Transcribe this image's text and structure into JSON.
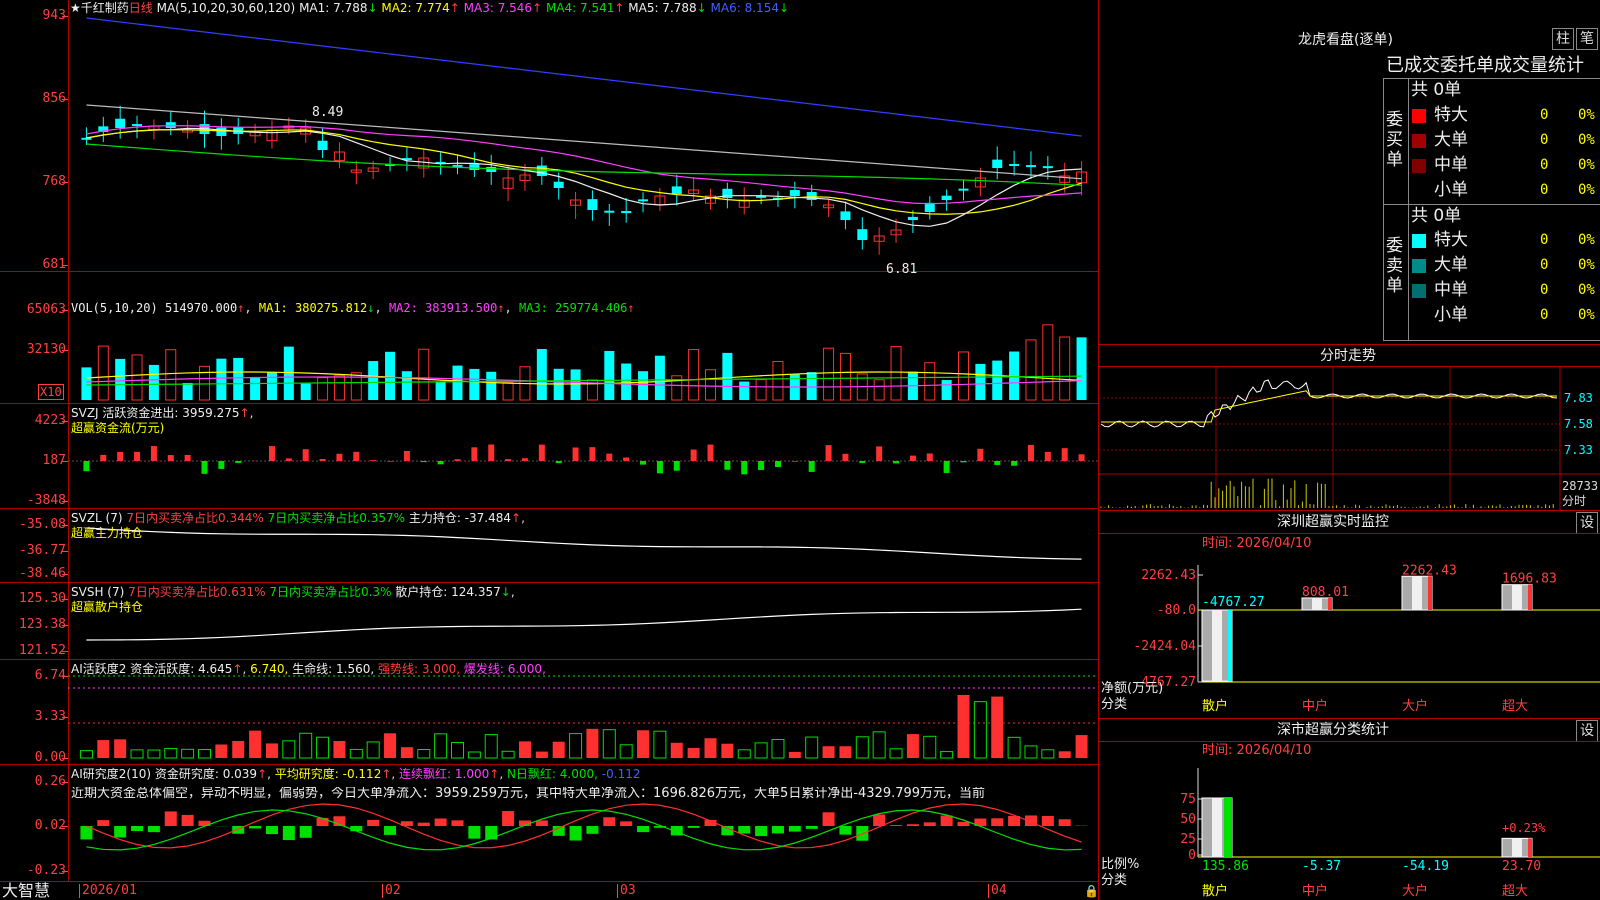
{
  "main_chart": {
    "stock_name": "★千红制药",
    "period": "日线",
    "ma_def": "MA(5,10,20,30,60,120)",
    "ma_values": [
      {
        "label": "MA1:",
        "value": "7.788",
        "arrow": "↓",
        "color": "#eeeeee"
      },
      {
        "label": "MA2:",
        "value": "7.774",
        "arrow": "↑",
        "color": "#ffff00"
      },
      {
        "label": "MA3:",
        "value": "7.546",
        "arrow": "↑",
        "color": "#ff40ff"
      },
      {
        "label": "MA4:",
        "value": "7.541",
        "arrow": "↑",
        "color": "#00e000"
      },
      {
        "label": "MA5:",
        "value": "7.788",
        "arrow": "↓",
        "color": "#eeeeee"
      },
      {
        "label": "MA6:",
        "value": "8.154",
        "arrow": "↓",
        "color": "#4060ff"
      }
    ],
    "y_ticks": [
      "943",
      "856",
      "768",
      "681"
    ],
    "high_marker": "8.49",
    "low_marker": "6.81"
  },
  "vol_panel": {
    "title": "VOL(5,10,20)",
    "value": "514970.000",
    "ma1": "MA1: 380275.812",
    "ma2": "MA2: 383913.500",
    "ma3": "MA3: 259774.406",
    "y_ticks": [
      "65063",
      "32130"
    ],
    "unit": "X10"
  },
  "svzj_panel": {
    "title": "SVZJ",
    "label": "活跃资金进出: 3959.275",
    "subtitle": "超赢资金流(万元)",
    "y_ticks": [
      "4223",
      "187",
      "-3848"
    ]
  },
  "svzl_panel": {
    "title": "SVZL (7)",
    "buy_ratio": "7日内买卖净占比0.344%",
    "sell_ratio": "7日内买卖净占比0.357%",
    "hold": "主力持仓: -37.484",
    "subtitle": "超赢主力持仓",
    "y_ticks": [
      "-35.08",
      "-36.77",
      "-38.46"
    ]
  },
  "svsh_panel": {
    "title": "SVSH (7)",
    "buy_ratio": "7日内买卖净占比0.631%",
    "sell_ratio": "7日内买卖净占比0.3%",
    "hold": "散户持仓: 124.357",
    "subtitle": "超赢散户持仓",
    "y_ticks": [
      "125.30",
      "123.38",
      "121.52"
    ]
  },
  "ai_active_panel": {
    "title": "AI活跃度2",
    "value": "资金活跃度: 4.645",
    "avg": "6.740,",
    "life": "生命线: 1.560,",
    "strong": "强势线: 3.000,",
    "burst": "爆发线: 6.000,",
    "y_ticks": [
      "6.74",
      "3.33",
      "0.00"
    ]
  },
  "ai_research_panel": {
    "title": "AI研究度2(10)",
    "value": "资金研究度: 0.039",
    "avg": "平均研究度: -0.112",
    "red_days": "连续飘红: 1.000",
    "n_days": "N日飘红: 4.000,",
    "extra": "-0.112",
    "comment": "近期大资金总体偏空，异动不明显，偏弱势，今日大单净流入：3959.259万元，其中特大单净流入：1696.826万元，大单5日累计净出-4329.799万元，当前",
    "y_ticks": [
      "0.26",
      "0.02",
      "-0.23"
    ]
  },
  "x_axis": {
    "brand": "大智慧",
    "labels": [
      "2026/01",
      "02",
      "03",
      "04"
    ]
  },
  "right": {
    "title": "龙虎看盘(逐单)",
    "btn1": "柱",
    "btn2": "笔",
    "order_title": "已成交委托单成交量统计",
    "buy": {
      "side": "委买单",
      "total": "共 0单",
      "rows": [
        {
          "name": "特大",
          "count": "0",
          "pct": "0%",
          "color": "#ff0000"
        },
        {
          "name": "大单",
          "count": "0",
          "pct": "0%",
          "color": "#a00000"
        },
        {
          "name": "中单",
          "count": "0",
          "pct": "0%",
          "color": "#800000"
        },
        {
          "name": "小单",
          "count": "0",
          "pct": "0%",
          "color": ""
        }
      ]
    },
    "sell": {
      "side": "委卖单",
      "total": "共 0单",
      "rows": [
        {
          "name": "特大",
          "count": "0",
          "pct": "0%",
          "color": "#00ffff"
        },
        {
          "name": "大单",
          "count": "0",
          "pct": "0%",
          "color": "#008b8b"
        },
        {
          "name": "中单",
          "count": "0",
          "pct": "0%",
          "color": "#006f6f"
        },
        {
          "name": "小单",
          "count": "0",
          "pct": "0%",
          "color": ""
        }
      ]
    },
    "intraday": {
      "title": "分时走势",
      "y_ticks": [
        "7.83",
        "7.58",
        "7.33"
      ],
      "vol_label": "28733",
      "unit": "分时"
    },
    "sz_monitor": {
      "title": "深圳超赢实时监控",
      "btn": "设",
      "time": "时间: 2026/04/10",
      "y_ticks": [
        "2262.43",
        "-80.0",
        "-2424.04",
        "-4767.27"
      ],
      "axis_label": "净额(万元)",
      "cat_label": "分类",
      "chart_data": {
        "type": "bar",
        "categories": [
          "散户",
          "中户",
          "大户",
          "超大"
        ],
        "values": [
          -4767.27,
          808.01,
          2262.43,
          1696.83
        ],
        "value_labels": [
          "-4767.27",
          "808.01",
          "2262.43",
          "1696.83"
        ],
        "ylim": [
          -4767.27,
          2262.43
        ],
        "ylabel": "净额(万元)",
        "xlabel": "分类"
      }
    },
    "sz_class": {
      "title": "深市超赢分类统计",
      "btn": "设",
      "time": "时间: 2026/04/10",
      "y_ticks": [
        "75",
        "50",
        "25",
        "0"
      ],
      "axis_label": "比例%",
      "cat_label": "分类",
      "pct_label": "+0.23%",
      "chart_data": {
        "type": "bar",
        "categories": [
          "散户",
          "中户",
          "大户",
          "超大"
        ],
        "values": [
          135.86,
          -5.37,
          -54.19,
          23.7
        ],
        "value_labels": [
          "135.86",
          "-5.37",
          "-54.19",
          "23.70"
        ],
        "ylim": [
          0,
          75
        ],
        "ylabel": "比例%",
        "xlabel": "分类"
      }
    }
  }
}
